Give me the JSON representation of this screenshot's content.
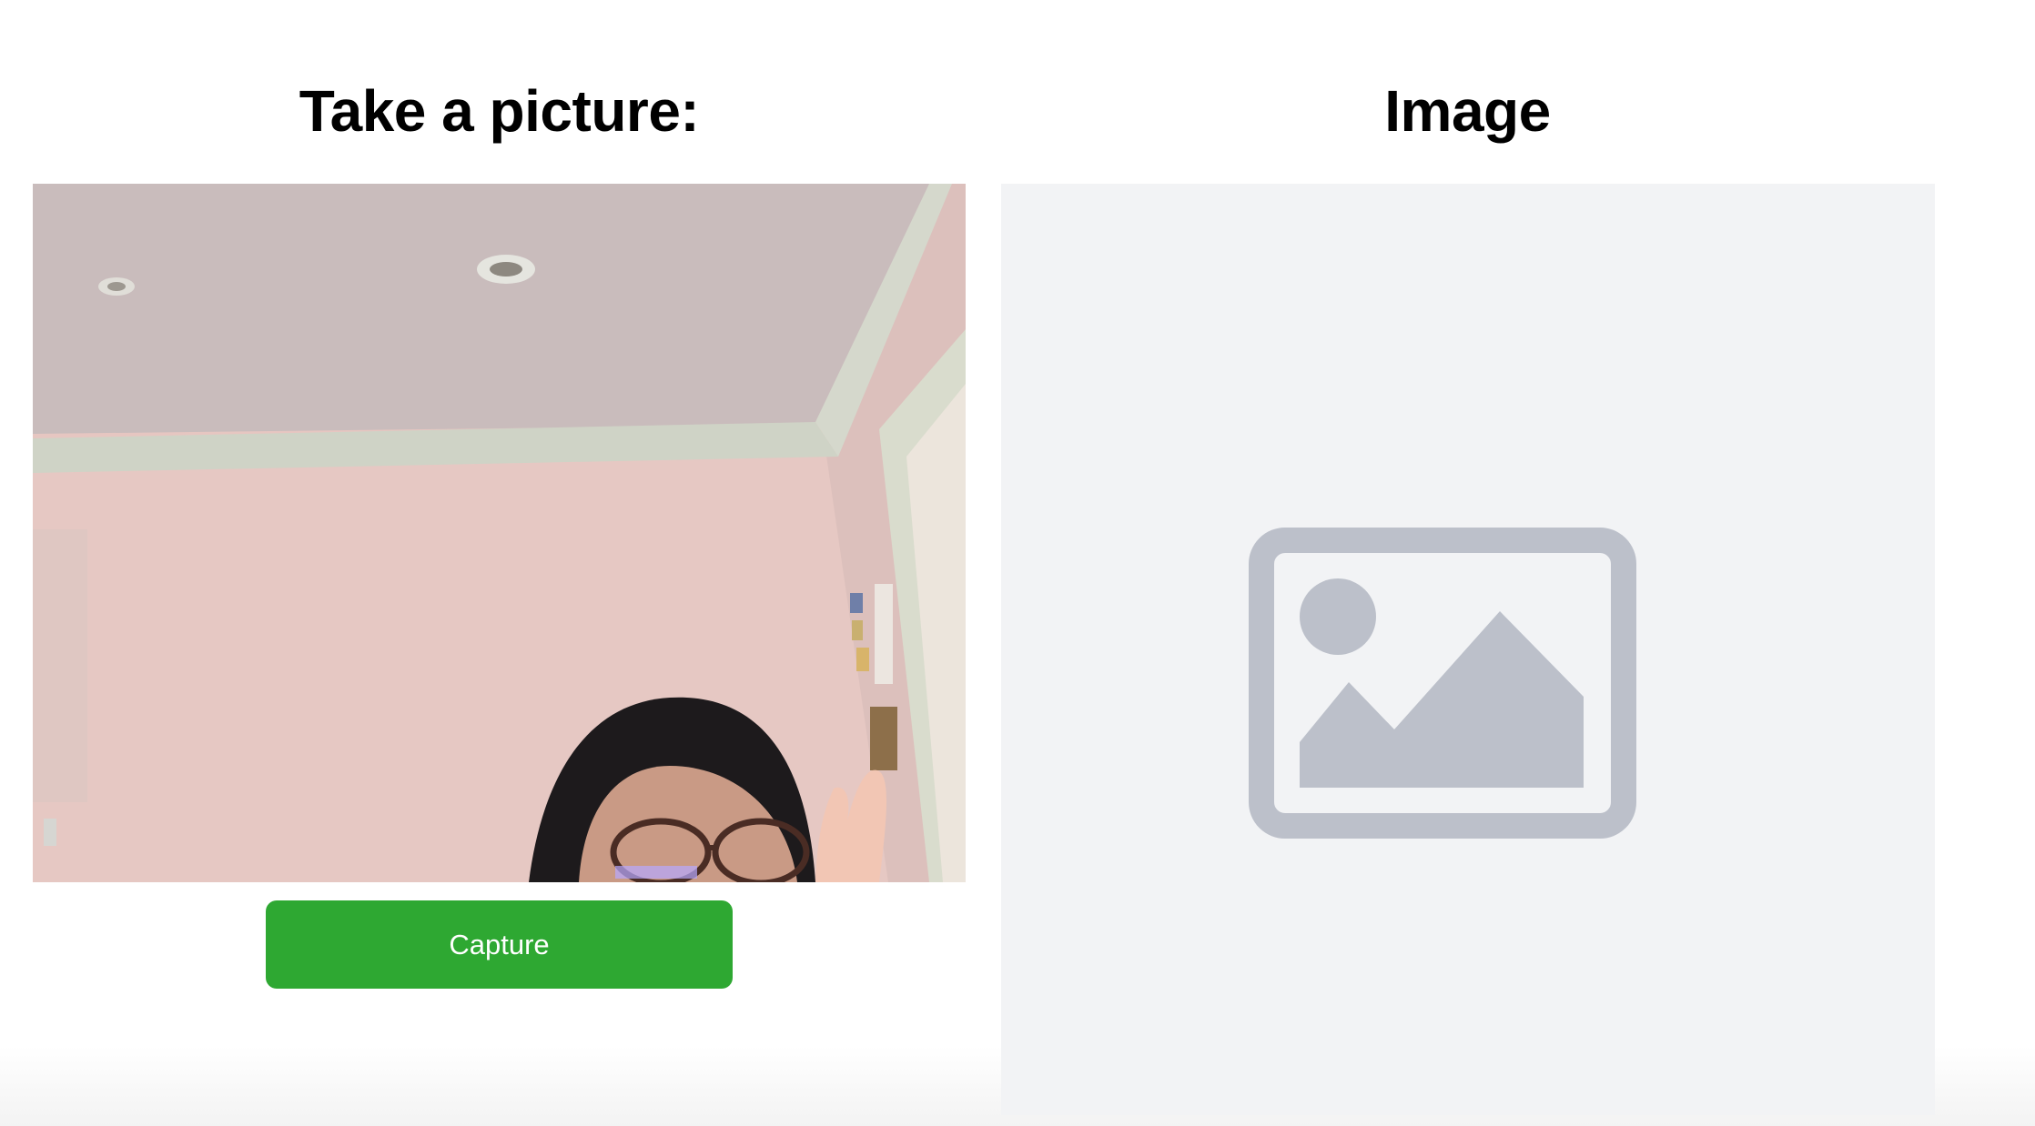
{
  "capture_section": {
    "title": "Take a picture:",
    "button_label": "Capture"
  },
  "image_section": {
    "title": "Image",
    "placeholder_icon": "image-placeholder-icon"
  },
  "colors": {
    "capture_button": "#2ea832",
    "panel_background": "#f2f3f5",
    "placeholder_icon": "#bcc0ca"
  }
}
